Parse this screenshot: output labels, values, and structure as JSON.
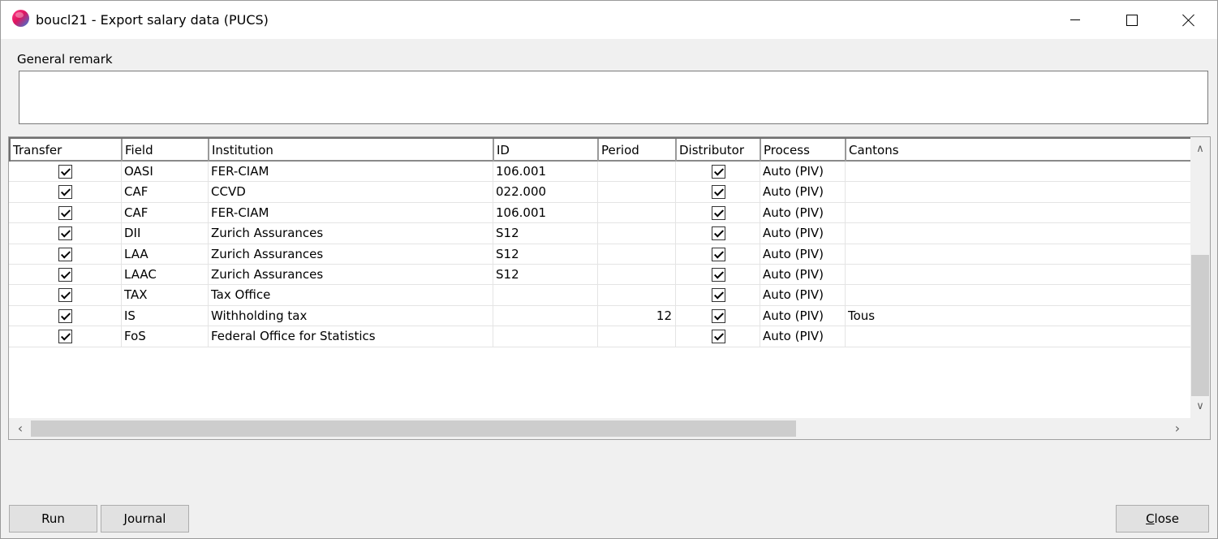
{
  "window": {
    "title": "boucl21 - Export salary data (PUCS)"
  },
  "remark": {
    "label": "General remark",
    "value": ""
  },
  "grid": {
    "columns": [
      "Transfer",
      "Field",
      "Institution",
      "ID",
      "Period",
      "Distributor",
      "Process",
      "Cantons"
    ],
    "rows": [
      {
        "transfer": true,
        "field": "OASI",
        "institution": "FER-CIAM",
        "id": "106.001",
        "period": "",
        "distributor": true,
        "process": "Auto (PIV)",
        "cantons": ""
      },
      {
        "transfer": true,
        "field": "CAF",
        "institution": "CCVD",
        "id": "022.000",
        "period": "",
        "distributor": true,
        "process": "Auto (PIV)",
        "cantons": ""
      },
      {
        "transfer": true,
        "field": "CAF",
        "institution": "FER-CIAM",
        "id": "106.001",
        "period": "",
        "distributor": true,
        "process": "Auto (PIV)",
        "cantons": ""
      },
      {
        "transfer": true,
        "field": "DII",
        "institution": "Zurich Assurances",
        "id": "S12",
        "period": "",
        "distributor": true,
        "process": "Auto (PIV)",
        "cantons": ""
      },
      {
        "transfer": true,
        "field": "LAA",
        "institution": "Zurich Assurances",
        "id": "S12",
        "period": "",
        "distributor": true,
        "process": "Auto (PIV)",
        "cantons": ""
      },
      {
        "transfer": true,
        "field": "LAAC",
        "institution": "Zurich Assurances",
        "id": "S12",
        "period": "",
        "distributor": true,
        "process": "Auto (PIV)",
        "cantons": ""
      },
      {
        "transfer": true,
        "field": "TAX",
        "institution": "Tax Office",
        "id": "",
        "period": "",
        "distributor": true,
        "process": "Auto (PIV)",
        "cantons": ""
      },
      {
        "transfer": true,
        "field": "IS",
        "institution": "Withholding tax",
        "id": "",
        "period": "12",
        "distributor": true,
        "process": "Auto (PIV)",
        "cantons": "Tous"
      },
      {
        "transfer": true,
        "field": "FoS",
        "institution": "Federal Office for Statistics",
        "id": "",
        "period": "",
        "distributor": true,
        "process": "Auto (PIV)",
        "cantons": ""
      }
    ]
  },
  "buttons": {
    "run": "Run",
    "journal": "Journal",
    "close": "Close"
  }
}
